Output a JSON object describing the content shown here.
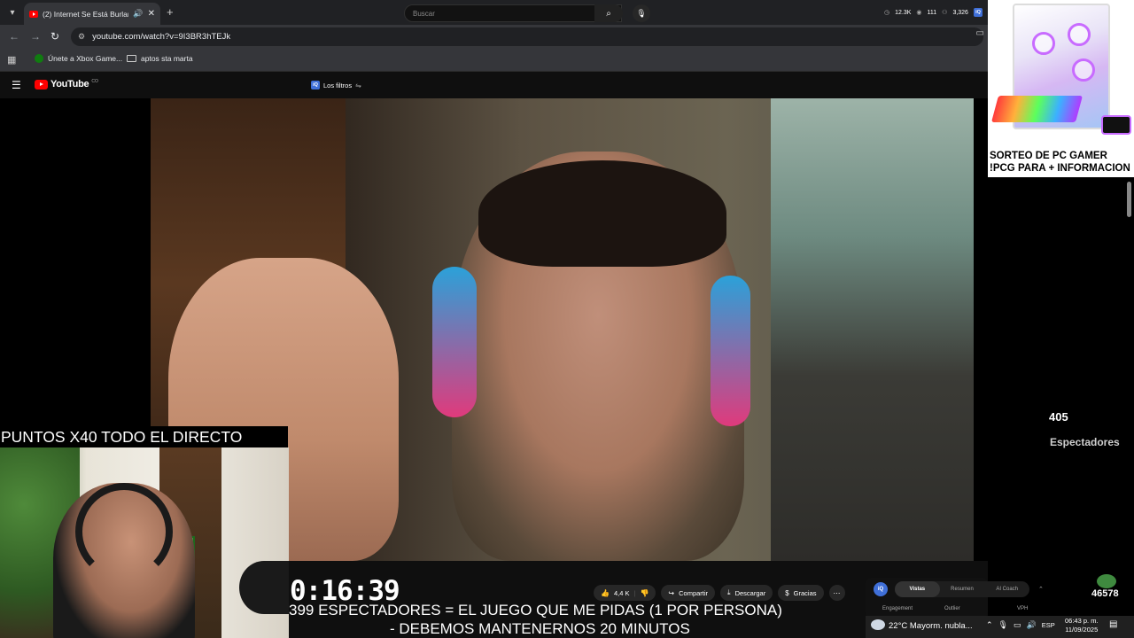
{
  "browser": {
    "tab_title": "(2) Internet Se Está Burlando",
    "new_tab_icon": "+",
    "url": "youtube.com/watch?v=9I3BR3hTEJk",
    "bookmarks": [
      {
        "label": "Únete a Xbox Game..."
      },
      {
        "label": "aptos sta marta"
      }
    ]
  },
  "youtube": {
    "logo_text": "YouTube",
    "country_code": "CO",
    "filters_label": "Los filtros",
    "search_placeholder": "Buscar",
    "stats": [
      "12.3K",
      "111",
      "3,326"
    ],
    "accent": "#ff0000"
  },
  "overlay": {
    "points_banner": "PUNTOS X40 TODO EL DIRECTO",
    "viewer_count": "405",
    "viewer_label": "Espectadores",
    "timer": "0:16:39",
    "subtitle_line1": "399 ESPECTADORES = EL JUEGO QUE ME PIDAS (1 POR PERSONA)",
    "subtitle_line2": "- DEBEMOS MANTENERNOS 20 MINUTOS",
    "emote_count": "46578"
  },
  "ad": {
    "line1": "SORTEO DE PC GAMER",
    "line2": "!PCG PARA + INFORMACION"
  },
  "actions": {
    "likes": "4,4 K",
    "share": "Compartir",
    "download": "Descargar",
    "thanks": "Gracias"
  },
  "iq_panel": {
    "logo": "iQ",
    "tabs": [
      "Vistas",
      "Resumen",
      "AI Coach"
    ],
    "metrics": [
      "Engagement",
      "Outlier",
      "VPH"
    ]
  },
  "taskbar": {
    "weather": "22°C  Mayorm. nubla...",
    "lang": "ESP",
    "time": "06:43 p. m.",
    "date": "11/09/2025"
  }
}
